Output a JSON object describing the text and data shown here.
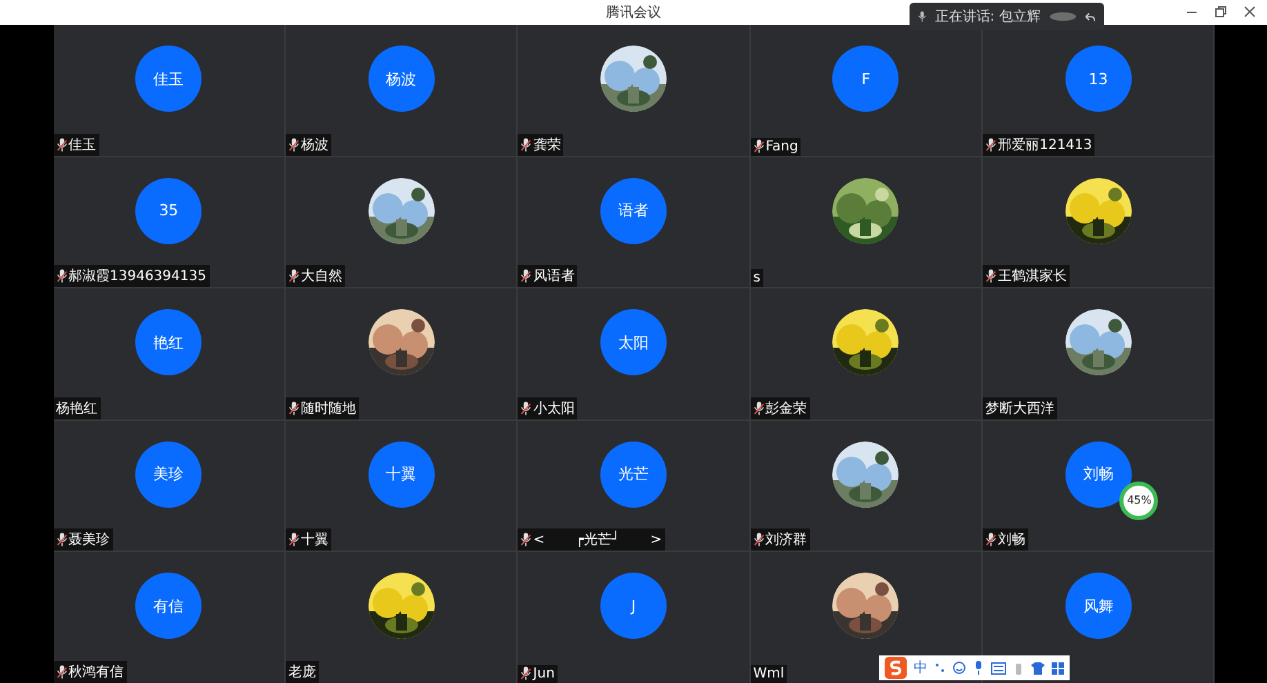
{
  "window": {
    "title": "腾讯会议"
  },
  "speaker_notice": {
    "text": "正在讲话: 包立辉"
  },
  "tiles": [
    {
      "avatar": {
        "kind": "initials",
        "text": "佳玉"
      },
      "name": "佳玉",
      "mic": true
    },
    {
      "avatar": {
        "kind": "initials",
        "text": "杨波"
      },
      "name": "杨波",
      "mic": true
    },
    {
      "name": "龚荣",
      "mic": true
    },
    {
      "avatar": {
        "kind": "initials",
        "text": "F"
      },
      "name": "Fang",
      "mic": true
    },
    {
      "avatar": {
        "kind": "initials",
        "text": "13"
      },
      "name": "邢爱丽121413",
      "mic": true
    },
    {
      "avatar": {
        "kind": "initials",
        "text": "35"
      },
      "name": "郝淑霞13946394135",
      "mic": true
    },
    {
      "name": "大自然",
      "mic": true
    },
    {
      "avatar": {
        "kind": "initials",
        "text": "语者"
      },
      "name": "风语者",
      "mic": true
    },
    {
      "name": "s",
      "mic": false
    },
    {
      "name": "王鹤淇家长",
      "mic": true
    },
    {
      "avatar": {
        "kind": "initials",
        "text": "艳红"
      },
      "name": "杨艳红",
      "mic": false
    },
    {
      "name": "随时随地",
      "mic": true
    },
    {
      "avatar": {
        "kind": "initials",
        "text": "太阳"
      },
      "name": "小太阳",
      "mic": true
    },
    {
      "name": "彭金荣",
      "mic": true
    },
    {
      "name": "梦断大西洋",
      "mic": false
    },
    {
      "avatar": {
        "kind": "initials",
        "text": "美珍"
      },
      "name": "聂美珍",
      "mic": true
    },
    {
      "avatar": {
        "kind": "initials",
        "text": "十翼"
      },
      "name": "十翼",
      "mic": true
    },
    {
      "avatar": {
        "kind": "initials",
        "text": "光芒"
      },
      "name": "<       ┍光芒┘       >",
      "mic": true
    },
    {
      "name": "刘济群",
      "mic": true
    },
    {
      "avatar": {
        "kind": "initials",
        "text": "刘畅"
      },
      "name": "刘畅",
      "mic": true,
      "badge": "45%"
    },
    {
      "avatar": {
        "kind": "initials",
        "text": "有信"
      },
      "name": "秋鸿有信",
      "mic": true
    },
    {
      "name": "老庞",
      "mic": false
    },
    {
      "avatar": {
        "kind": "initials",
        "text": "J"
      },
      "name": "Jun",
      "mic": true
    },
    {
      "name": "Wml",
      "mic": false
    },
    {
      "avatar": {
        "kind": "initials",
        "text": "风舞"
      }
    }
  ],
  "ime_toolbar": {
    "mode": "中"
  }
}
